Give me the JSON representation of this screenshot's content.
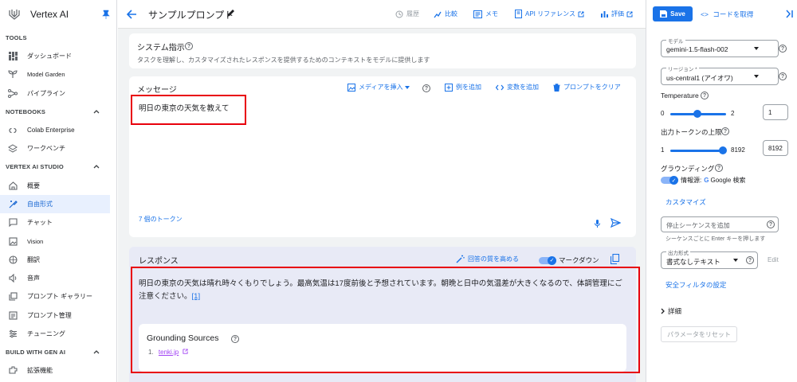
{
  "app": {
    "title": "Vertex AI"
  },
  "sidebar": {
    "sections": [
      {
        "label": "TOOLS"
      },
      {
        "label": "NOTEBOOKS"
      },
      {
        "label": "VERTEX AI STUDIO"
      },
      {
        "label": "BUILD WITH GEN AI"
      }
    ],
    "tools": [
      {
        "label": "ダッシュボード",
        "icon": "dashboard-icon"
      },
      {
        "label": "Model Garden",
        "icon": "model-garden-icon"
      },
      {
        "label": "パイプライン",
        "icon": "pipeline-icon"
      }
    ],
    "notebooks": [
      {
        "label": "Colab Enterprise",
        "icon": "colab-icon"
      },
      {
        "label": "ワークベンチ",
        "icon": "workbench-icon"
      }
    ],
    "studio": [
      {
        "label": "概要",
        "icon": "home-icon"
      },
      {
        "label": "自由形式",
        "icon": "freeform-icon",
        "active": true
      },
      {
        "label": "チャット",
        "icon": "chat-icon"
      },
      {
        "label": "Vision",
        "icon": "vision-icon"
      },
      {
        "label": "翻訳",
        "icon": "translate-icon"
      },
      {
        "label": "音声",
        "icon": "speech-icon"
      },
      {
        "label": "プロンプト ギャラリー",
        "icon": "gallery-icon"
      },
      {
        "label": "プロンプト管理",
        "icon": "prompt-manage-icon"
      },
      {
        "label": "チューニング",
        "icon": "tuning-icon"
      }
    ],
    "build": [
      {
        "label": "拡張機能",
        "icon": "extensions-icon"
      }
    ]
  },
  "topbar": {
    "prompt_title": "サンプルプロンプト",
    "history": "履歴",
    "compare": "比較",
    "memo": "メモ",
    "api_ref": "API リファレンス",
    "evaluate": "評価"
  },
  "system": {
    "title": "システム指示",
    "description": "タスクを理解し、カスタマイズされたレスポンスを提供するためのコンテキストをモデルに提供します"
  },
  "message": {
    "title": "メッセージ",
    "insert_media": "メディアを挿入",
    "add_example": "例を追加",
    "add_variable": "変数を追加",
    "clear_prompt": "プロンプトをクリア",
    "text": "明日の東京の天気を教えて",
    "tokens": "7 個のトークン"
  },
  "response": {
    "title": "レスポンス",
    "improve": "回答の質を高める",
    "markdown": "マークダウン",
    "text": "明日の東京の天気は晴れ時々くもりでしょう。最高気温は17度前後と予想されています。朝晩と日中の気温差が大きくなるので、体調管理にご注意ください。",
    "citation": "[1]",
    "grounding_title": "Grounding Sources",
    "source_num": "1.",
    "source_link": "tenki.jp"
  },
  "right": {
    "save": "Save",
    "get_code": "コードを取得",
    "model_label": "モデル",
    "model_value": "gemini-1.5-flash-002",
    "region_label": "リージョン *",
    "region_value": "us-central1 (アイオワ)",
    "temperature_label": "Temperature",
    "temp_min": "0",
    "temp_max": "2",
    "temp_value": "1",
    "temp_fraction": 0.5,
    "tokens_label": "出力トークンの上限",
    "tokens_min": "1",
    "tokens_max": "8192",
    "tokens_value": "8192",
    "grounding_label": "グラウンディング",
    "grounding_source": "情報源:",
    "grounding_google": "Google 検索",
    "customize": "カスタマイズ",
    "stop_placeholder": "停止シーケンスを追加",
    "stop_hint": "シーケンスごとに Enter キーを押します",
    "output_label": "出力形式",
    "output_value": "書式なしテキスト",
    "edit": "Edit",
    "safety": "安全フィルタの設定",
    "details": "詳細",
    "reset": "パラメータをリセット"
  },
  "colors": {
    "accent": "#1a73e8",
    "highlight": "#e8000b",
    "response_bg": "#e8eaf6"
  }
}
